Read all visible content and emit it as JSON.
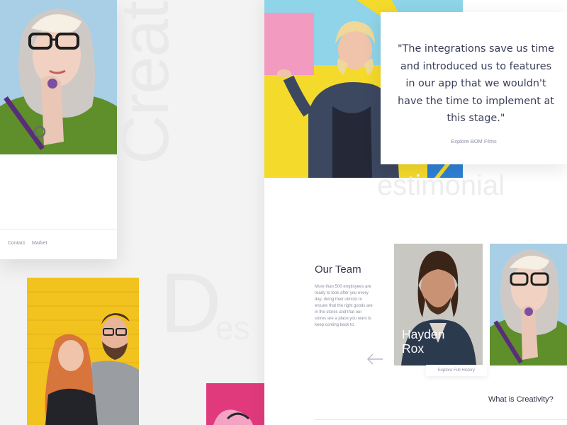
{
  "watermarks": {
    "creative": "Creative",
    "design_d": "D",
    "design_es": "es",
    "testimonial": "estimonial"
  },
  "left_card": {
    "nav": [
      "Contact",
      "Market"
    ]
  },
  "testimonial": {
    "quote": "\"The integrations save us time and introduced us to features in our app that we wouldn't have the time to implement at this stage.\"",
    "link_label": "Explore BOM Films"
  },
  "team": {
    "title": "Our Team",
    "description": "More than 500 employees are ready to look after you every day, doing their utmost to ensure that the right goods are in the stores and that our stores are a place you want to keep coming back to.",
    "member_name": "Hayden\nRox",
    "member_link_label": "Explore Full History"
  },
  "creativity_heading": "What is Creativity?",
  "icons": {
    "arrow": "arrow-left-icon"
  },
  "colors": {
    "accent_yellow": "#f4da2a",
    "accent_pink": "#e03a7d",
    "sky_blue": "#a8cfe6",
    "text_dark": "#33364f"
  }
}
